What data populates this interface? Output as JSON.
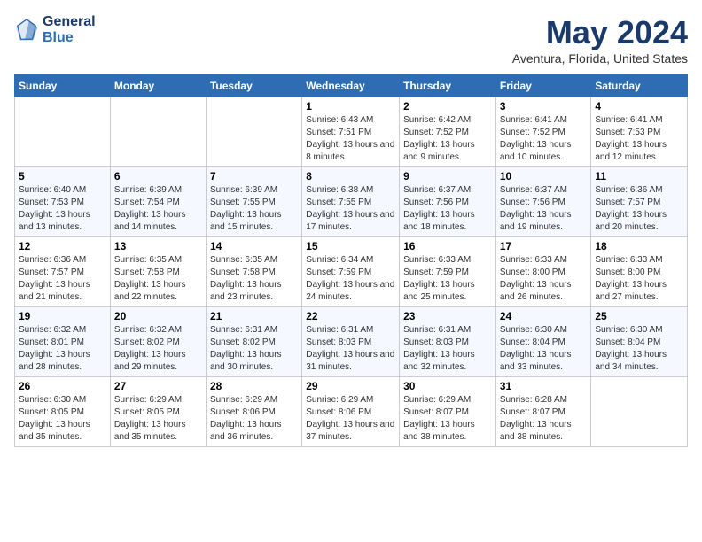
{
  "header": {
    "logo_line1": "General",
    "logo_line2": "Blue",
    "month": "May 2024",
    "location": "Aventura, Florida, United States"
  },
  "weekdays": [
    "Sunday",
    "Monday",
    "Tuesday",
    "Wednesday",
    "Thursday",
    "Friday",
    "Saturday"
  ],
  "weeks": [
    [
      {
        "day": "",
        "sunrise": "",
        "sunset": "",
        "daylight": ""
      },
      {
        "day": "",
        "sunrise": "",
        "sunset": "",
        "daylight": ""
      },
      {
        "day": "",
        "sunrise": "",
        "sunset": "",
        "daylight": ""
      },
      {
        "day": "1",
        "sunrise": "Sunrise: 6:43 AM",
        "sunset": "Sunset: 7:51 PM",
        "daylight": "Daylight: 13 hours and 8 minutes."
      },
      {
        "day": "2",
        "sunrise": "Sunrise: 6:42 AM",
        "sunset": "Sunset: 7:52 PM",
        "daylight": "Daylight: 13 hours and 9 minutes."
      },
      {
        "day": "3",
        "sunrise": "Sunrise: 6:41 AM",
        "sunset": "Sunset: 7:52 PM",
        "daylight": "Daylight: 13 hours and 10 minutes."
      },
      {
        "day": "4",
        "sunrise": "Sunrise: 6:41 AM",
        "sunset": "Sunset: 7:53 PM",
        "daylight": "Daylight: 13 hours and 12 minutes."
      }
    ],
    [
      {
        "day": "5",
        "sunrise": "Sunrise: 6:40 AM",
        "sunset": "Sunset: 7:53 PM",
        "daylight": "Daylight: 13 hours and 13 minutes."
      },
      {
        "day": "6",
        "sunrise": "Sunrise: 6:39 AM",
        "sunset": "Sunset: 7:54 PM",
        "daylight": "Daylight: 13 hours and 14 minutes."
      },
      {
        "day": "7",
        "sunrise": "Sunrise: 6:39 AM",
        "sunset": "Sunset: 7:55 PM",
        "daylight": "Daylight: 13 hours and 15 minutes."
      },
      {
        "day": "8",
        "sunrise": "Sunrise: 6:38 AM",
        "sunset": "Sunset: 7:55 PM",
        "daylight": "Daylight: 13 hours and 17 minutes."
      },
      {
        "day": "9",
        "sunrise": "Sunrise: 6:37 AM",
        "sunset": "Sunset: 7:56 PM",
        "daylight": "Daylight: 13 hours and 18 minutes."
      },
      {
        "day": "10",
        "sunrise": "Sunrise: 6:37 AM",
        "sunset": "Sunset: 7:56 PM",
        "daylight": "Daylight: 13 hours and 19 minutes."
      },
      {
        "day": "11",
        "sunrise": "Sunrise: 6:36 AM",
        "sunset": "Sunset: 7:57 PM",
        "daylight": "Daylight: 13 hours and 20 minutes."
      }
    ],
    [
      {
        "day": "12",
        "sunrise": "Sunrise: 6:36 AM",
        "sunset": "Sunset: 7:57 PM",
        "daylight": "Daylight: 13 hours and 21 minutes."
      },
      {
        "day": "13",
        "sunrise": "Sunrise: 6:35 AM",
        "sunset": "Sunset: 7:58 PM",
        "daylight": "Daylight: 13 hours and 22 minutes."
      },
      {
        "day": "14",
        "sunrise": "Sunrise: 6:35 AM",
        "sunset": "Sunset: 7:58 PM",
        "daylight": "Daylight: 13 hours and 23 minutes."
      },
      {
        "day": "15",
        "sunrise": "Sunrise: 6:34 AM",
        "sunset": "Sunset: 7:59 PM",
        "daylight": "Daylight: 13 hours and 24 minutes."
      },
      {
        "day": "16",
        "sunrise": "Sunrise: 6:33 AM",
        "sunset": "Sunset: 7:59 PM",
        "daylight": "Daylight: 13 hours and 25 minutes."
      },
      {
        "day": "17",
        "sunrise": "Sunrise: 6:33 AM",
        "sunset": "Sunset: 8:00 PM",
        "daylight": "Daylight: 13 hours and 26 minutes."
      },
      {
        "day": "18",
        "sunrise": "Sunrise: 6:33 AM",
        "sunset": "Sunset: 8:00 PM",
        "daylight": "Daylight: 13 hours and 27 minutes."
      }
    ],
    [
      {
        "day": "19",
        "sunrise": "Sunrise: 6:32 AM",
        "sunset": "Sunset: 8:01 PM",
        "daylight": "Daylight: 13 hours and 28 minutes."
      },
      {
        "day": "20",
        "sunrise": "Sunrise: 6:32 AM",
        "sunset": "Sunset: 8:02 PM",
        "daylight": "Daylight: 13 hours and 29 minutes."
      },
      {
        "day": "21",
        "sunrise": "Sunrise: 6:31 AM",
        "sunset": "Sunset: 8:02 PM",
        "daylight": "Daylight: 13 hours and 30 minutes."
      },
      {
        "day": "22",
        "sunrise": "Sunrise: 6:31 AM",
        "sunset": "Sunset: 8:03 PM",
        "daylight": "Daylight: 13 hours and 31 minutes."
      },
      {
        "day": "23",
        "sunrise": "Sunrise: 6:31 AM",
        "sunset": "Sunset: 8:03 PM",
        "daylight": "Daylight: 13 hours and 32 minutes."
      },
      {
        "day": "24",
        "sunrise": "Sunrise: 6:30 AM",
        "sunset": "Sunset: 8:04 PM",
        "daylight": "Daylight: 13 hours and 33 minutes."
      },
      {
        "day": "25",
        "sunrise": "Sunrise: 6:30 AM",
        "sunset": "Sunset: 8:04 PM",
        "daylight": "Daylight: 13 hours and 34 minutes."
      }
    ],
    [
      {
        "day": "26",
        "sunrise": "Sunrise: 6:30 AM",
        "sunset": "Sunset: 8:05 PM",
        "daylight": "Daylight: 13 hours and 35 minutes."
      },
      {
        "day": "27",
        "sunrise": "Sunrise: 6:29 AM",
        "sunset": "Sunset: 8:05 PM",
        "daylight": "Daylight: 13 hours and 35 minutes."
      },
      {
        "day": "28",
        "sunrise": "Sunrise: 6:29 AM",
        "sunset": "Sunset: 8:06 PM",
        "daylight": "Daylight: 13 hours and 36 minutes."
      },
      {
        "day": "29",
        "sunrise": "Sunrise: 6:29 AM",
        "sunset": "Sunset: 8:06 PM",
        "daylight": "Daylight: 13 hours and 37 minutes."
      },
      {
        "day": "30",
        "sunrise": "Sunrise: 6:29 AM",
        "sunset": "Sunset: 8:07 PM",
        "daylight": "Daylight: 13 hours and 38 minutes."
      },
      {
        "day": "31",
        "sunrise": "Sunrise: 6:28 AM",
        "sunset": "Sunset: 8:07 PM",
        "daylight": "Daylight: 13 hours and 38 minutes."
      },
      {
        "day": "",
        "sunrise": "",
        "sunset": "",
        "daylight": ""
      }
    ]
  ]
}
